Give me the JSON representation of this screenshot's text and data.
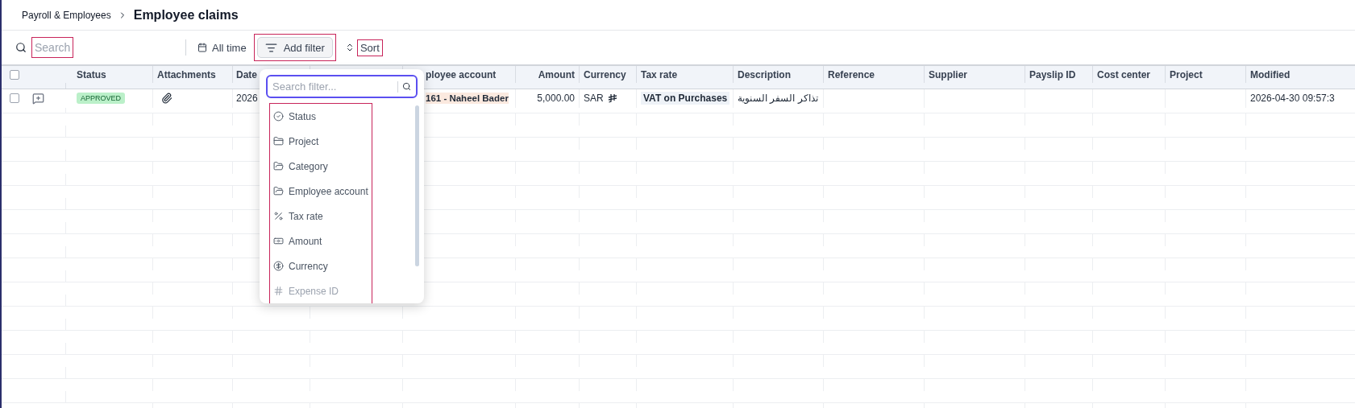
{
  "breadcrumb": {
    "parent": "Payroll & Employees",
    "title": "Employee claims"
  },
  "toolbar": {
    "search": {
      "placeholder": "Search",
      "highlighted": true
    },
    "date_range": "All time",
    "add_filter": {
      "label": "Add filter",
      "highlighted": true
    },
    "sort": {
      "label": "Sort",
      "highlighted": true
    }
  },
  "table": {
    "select_all": {
      "checked": false
    },
    "columns": [
      {
        "label": "Status",
        "kind": "status"
      },
      {
        "label": "Attachments",
        "kind": "attachments"
      },
      {
        "label": "Date",
        "kind": "text"
      },
      {
        "kind": "text"
      },
      {
        "label": "ployee account",
        "kind": "account"
      },
      {
        "label": "Amount",
        "kind": "amount"
      },
      {
        "label": "Currency",
        "kind": "currency"
      },
      {
        "label": "Tax rate",
        "kind": "tax"
      },
      {
        "label": "Description",
        "kind": "text"
      },
      {
        "label": "Reference",
        "kind": "text"
      },
      {
        "label": "Supplier",
        "kind": "text"
      },
      {
        "label": "Payslip ID",
        "kind": "text"
      },
      {
        "label": "Cost center",
        "kind": "text"
      },
      {
        "label": "Project",
        "kind": "text"
      },
      {
        "label": "Modified",
        "kind": "text"
      }
    ],
    "rows": [
      {
        "checked": false,
        "attachment": true,
        "cells": [
          "APPROVED",
          null,
          "2026",
          null,
          "161 - Naheel Bader",
          "5,000.00",
          "SAR",
          "VAT on Purchases",
          "تذاكر السفر السنوية",
          null,
          null,
          null,
          null,
          null,
          "2026-04-30 09:57:3"
        ]
      }
    ]
  },
  "filter_menu": {
    "placeholder": "Search filter...",
    "highlighted": true,
    "items": [
      {
        "label": "Status",
        "kind": "status",
        "faded": false
      },
      {
        "label": "Project",
        "kind": "project",
        "faded": false
      },
      {
        "label": "Category",
        "kind": "folder",
        "faded": false
      },
      {
        "label": "Employee account",
        "kind": "folder",
        "faded": false
      },
      {
        "label": "Tax rate",
        "kind": "percent",
        "faded": false
      },
      {
        "label": "Amount",
        "kind": "money",
        "faded": false
      },
      {
        "label": "Currency",
        "kind": "currency",
        "faded": false
      },
      {
        "label": "Expense ID",
        "kind": "hash",
        "faded": true
      }
    ]
  }
}
